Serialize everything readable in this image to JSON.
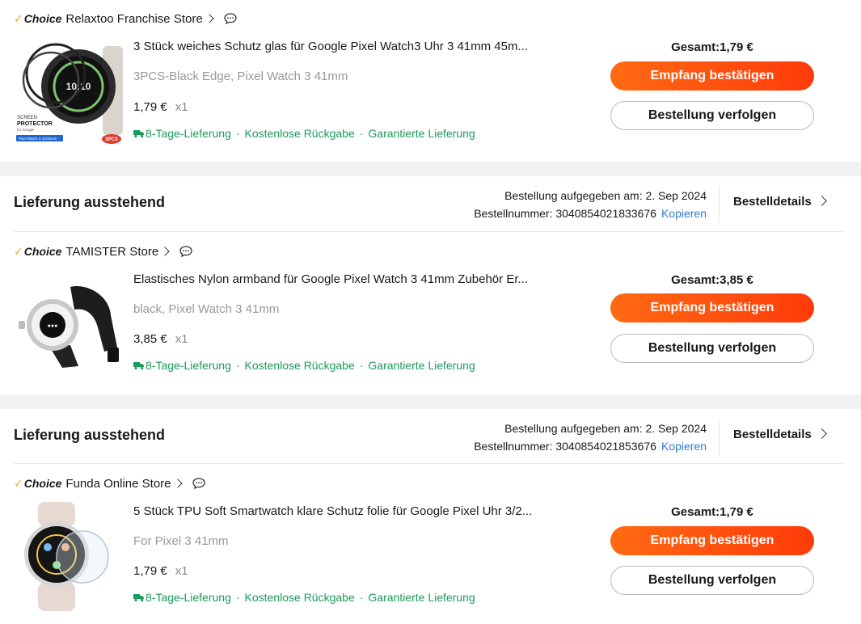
{
  "colors": {
    "accent": "#ff4f10",
    "perk_green": "#1a9a5b",
    "link_blue": "#2e7bd6",
    "choice_tick": "#f5a623"
  },
  "choice_label": "Choice",
  "orders": [
    {
      "status": "",
      "placed_label": "",
      "order_no_label": "",
      "copy_label": "",
      "details_label": "",
      "store": "Relaxtoo Franchise Store",
      "product": {
        "title": "3 Stück weiches Schutz glas für Google Pixel Watch3 Uhr 3 41mm 45m...",
        "variant": "3PCS-Black Edge, Pixel Watch 3 41mm",
        "price": "1,79 €",
        "qty": "x1",
        "image_icon": "screen-protector-image",
        "image_text_1": "SCREEN",
        "image_text_2": "PROTECTOR",
        "image_text_3": "for Google",
        "image_text_4": "Pixel Watch 3 41/45mm",
        "image_badge": "3PCS"
      },
      "perks": [
        "8-Tage-Lieferung",
        "Kostenlose Rückgabe",
        "Garantierte Lieferung"
      ],
      "total": "Gesamt:1,79 €",
      "confirm_label": "Empfang bestätigen",
      "track_label": "Bestellung verfolgen"
    },
    {
      "status": "Lieferung ausstehend",
      "placed_label": "Bestellung aufgegeben am: 2. Sep 2024",
      "order_no_label": "Bestellnummer: 3040854021833676",
      "copy_label": "Kopieren",
      "details_label": "Bestelldetails",
      "store": "TAMISTER Store",
      "product": {
        "title": "Elastisches Nylon armband für Google Pixel Watch 3 41mm Zubehör Er...",
        "variant": "black, Pixel Watch 3 41mm",
        "price": "3,85 €",
        "qty": "x1",
        "image_icon": "nylon-band-image"
      },
      "perks": [
        "8-Tage-Lieferung",
        "Kostenlose Rückgabe",
        "Garantierte Lieferung"
      ],
      "total": "Gesamt:3,85 €",
      "confirm_label": "Empfang bestätigen",
      "track_label": "Bestellung verfolgen"
    },
    {
      "status": "Lieferung ausstehend",
      "placed_label": "Bestellung aufgegeben am: 2. Sep 2024",
      "order_no_label": "Bestellnummer: 3040854021853676",
      "copy_label": "Kopieren",
      "details_label": "Bestelldetails",
      "store": "Funda Online Store",
      "product": {
        "title": "5 Stück TPU Soft Smartwatch klare Schutz folie für Google Pixel Uhr 3/2...",
        "variant": "For Pixel 3 41mm",
        "price": "1,79 €",
        "qty": "x1",
        "image_icon": "tpu-film-image"
      },
      "perks": [
        "8-Tage-Lieferung",
        "Kostenlose Rückgabe",
        "Garantierte Lieferung"
      ],
      "total": "Gesamt:1,79 €",
      "confirm_label": "Empfang bestätigen",
      "track_label": "Bestellung verfolgen"
    }
  ]
}
